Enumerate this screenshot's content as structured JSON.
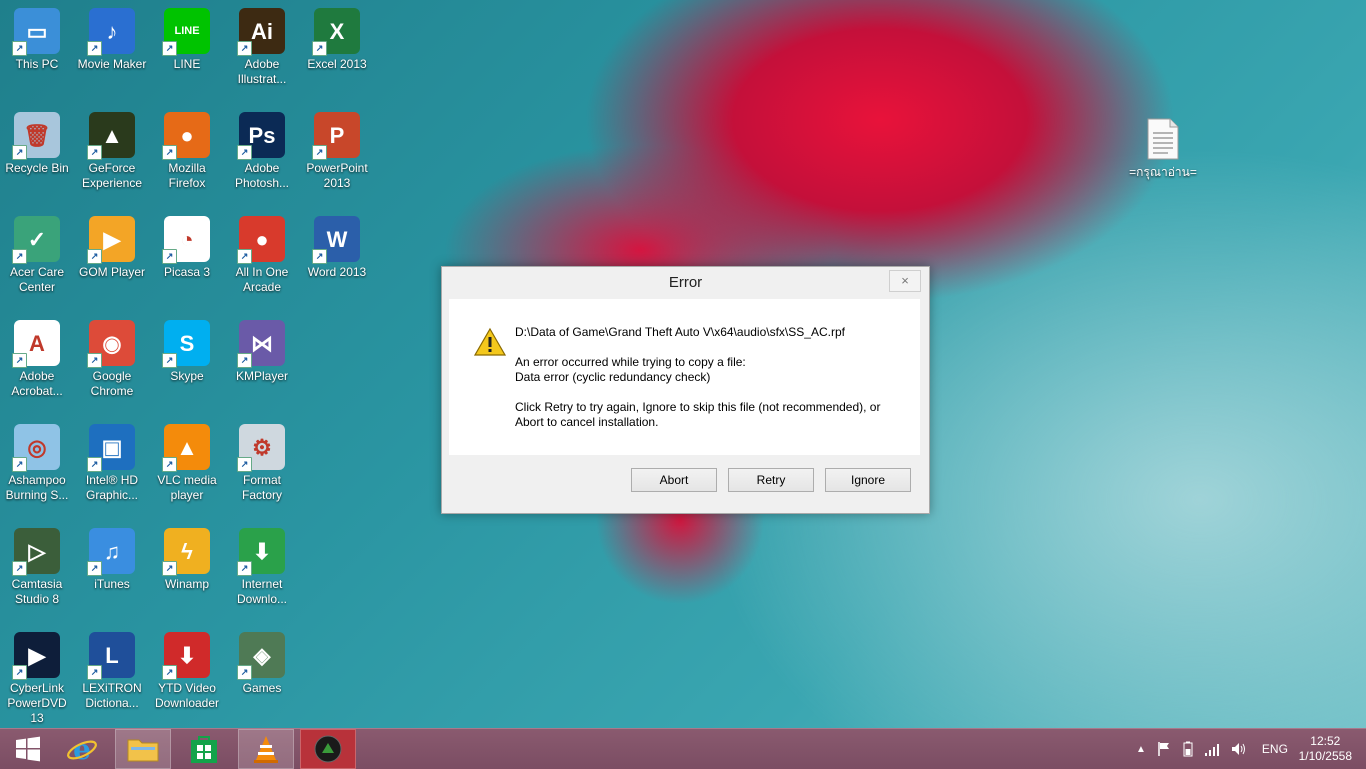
{
  "desktop": {
    "icons": [
      {
        "label": "This PC",
        "col": 0,
        "row": 0,
        "color": "#3b8fd8",
        "glyph": "▭"
      },
      {
        "label": "Movie Maker",
        "col": 1,
        "row": 0,
        "color": "#2a6fd1",
        "glyph": "♪"
      },
      {
        "label": "LINE",
        "col": 2,
        "row": 0,
        "color": "#00c300",
        "glyph": "LINE"
      },
      {
        "label": "Adobe Illustrat...",
        "col": 3,
        "row": 0,
        "color": "#3d2a12",
        "glyph": "Ai"
      },
      {
        "label": "Excel 2013",
        "col": 4,
        "row": 0,
        "color": "#1f7a3e",
        "glyph": "X"
      },
      {
        "label": "Recycle Bin",
        "col": 0,
        "row": 1,
        "color": "#a8c6dc",
        "glyph": "🗑"
      },
      {
        "label": "GeForce Experience",
        "col": 1,
        "row": 1,
        "color": "#2a3a1c",
        "glyph": "▲"
      },
      {
        "label": "Mozilla Firefox",
        "col": 2,
        "row": 1,
        "color": "#e66a17",
        "glyph": "●"
      },
      {
        "label": "Adobe Photosh...",
        "col": 3,
        "row": 1,
        "color": "#0b2a55",
        "glyph": "Ps"
      },
      {
        "label": "PowerPoint 2013",
        "col": 4,
        "row": 1,
        "color": "#c8472a",
        "glyph": "P"
      },
      {
        "label": "Acer Care Center",
        "col": 0,
        "row": 2,
        "color": "#3aa37a",
        "glyph": "✓"
      },
      {
        "label": "GOM Player",
        "col": 1,
        "row": 2,
        "color": "#f3a526",
        "glyph": "▶"
      },
      {
        "label": "Picasa 3",
        "col": 2,
        "row": 2,
        "color": "#ffffff",
        "glyph": "◔"
      },
      {
        "label": "All In One Arcade",
        "col": 3,
        "row": 2,
        "color": "#d83a2c",
        "glyph": "●"
      },
      {
        "label": "Word 2013",
        "col": 4,
        "row": 2,
        "color": "#2b5faa",
        "glyph": "W"
      },
      {
        "label": "Adobe Acrobat...",
        "col": 0,
        "row": 3,
        "color": "#ffffff",
        "glyph": "A"
      },
      {
        "label": "Google Chrome",
        "col": 1,
        "row": 3,
        "color": "#dd4b39",
        "glyph": "◉"
      },
      {
        "label": "Skype",
        "col": 2,
        "row": 3,
        "color": "#00aff0",
        "glyph": "S"
      },
      {
        "label": "KMPlayer",
        "col": 3,
        "row": 3,
        "color": "#6a5aa8",
        "glyph": "⋈"
      },
      {
        "label": "Ashampoo Burning S...",
        "col": 0,
        "row": 4,
        "color": "#8fc3e6",
        "glyph": "◎"
      },
      {
        "label": "Intel® HD Graphic...",
        "col": 1,
        "row": 4,
        "color": "#1e6fbf",
        "glyph": "▣"
      },
      {
        "label": "VLC media player",
        "col": 2,
        "row": 4,
        "color": "#f48b0b",
        "glyph": "▲"
      },
      {
        "label": "Format Factory",
        "col": 3,
        "row": 4,
        "color": "#cfd8df",
        "glyph": "⚙"
      },
      {
        "label": "Camtasia Studio 8",
        "col": 0,
        "row": 5,
        "color": "#3b5e3a",
        "glyph": "▷"
      },
      {
        "label": "iTunes",
        "col": 1,
        "row": 5,
        "color": "#3a8ee0",
        "glyph": "♫"
      },
      {
        "label": "Winamp",
        "col": 2,
        "row": 5,
        "color": "#f0b020",
        "glyph": "ϟ"
      },
      {
        "label": "Internet Downlo...",
        "col": 3,
        "row": 5,
        "color": "#2aa14a",
        "glyph": "⬇"
      },
      {
        "label": "CyberLink PowerDVD 13",
        "col": 0,
        "row": 6,
        "color": "#0e1e3a",
        "glyph": "▶"
      },
      {
        "label": "LEXiTRON Dictiona...",
        "col": 1,
        "row": 6,
        "color": "#1f4f9a",
        "glyph": "L"
      },
      {
        "label": "YTD Video Downloader",
        "col": 2,
        "row": 6,
        "color": "#d02a2a",
        "glyph": "⬇"
      },
      {
        "label": "Games",
        "col": 3,
        "row": 6,
        "color": "#4f7a55",
        "glyph": "◈"
      }
    ],
    "file_icon_label": "=กรุณาอ่าน="
  },
  "dialog": {
    "title": "Error",
    "close_glyph": "×",
    "path": "D:\\Data of Game\\Grand Theft Auto V\\x64\\audio\\sfx\\SS_AC.rpf",
    "error_line1": "An error occurred while trying to copy a file:",
    "error_line2": "Data error (cyclic redundancy check)",
    "hint_line1": "Click Retry to try again, Ignore to skip this file (not recommended), or",
    "hint_line2": "Abort to cancel installation.",
    "buttons": {
      "abort": "Abort",
      "retry": "Retry",
      "ignore": "Ignore"
    }
  },
  "taskbar": {
    "language": "ENG",
    "time": "12:52",
    "date": "1/10/2558"
  },
  "colors": {
    "warning_yellow": "#f4c81c",
    "taskbar": "#7b4d63"
  }
}
